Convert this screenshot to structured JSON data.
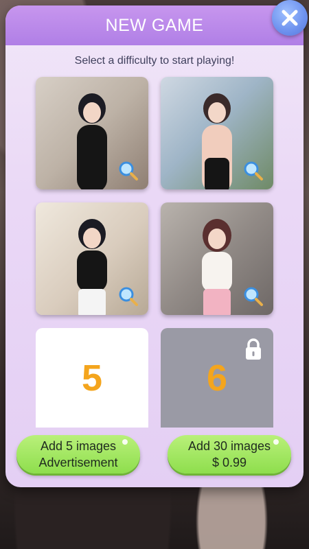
{
  "header": {
    "title": "NEW GAME",
    "close_icon": "close-icon"
  },
  "subtitle": "Select a difficulty to start playing!",
  "thumbnails": [
    {
      "name": "image-1",
      "icon": "magnifier-icon"
    },
    {
      "name": "image-2",
      "icon": "magnifier-icon"
    },
    {
      "name": "image-3",
      "icon": "magnifier-icon"
    },
    {
      "name": "image-4",
      "icon": "magnifier-icon"
    }
  ],
  "levels": [
    {
      "value": "5",
      "locked": false
    },
    {
      "value": "6",
      "locked": true,
      "icon": "lock-icon"
    }
  ],
  "buttons": {
    "ad": {
      "line1": "Add 5 images",
      "line2": "Advertisement"
    },
    "purchase": {
      "line1": "Add 30 images",
      "line2": "$ 0.99"
    }
  },
  "colors": {
    "header": "#b07fe6",
    "panel": "#ead8f6",
    "close_button": "#6d91ee",
    "level_number": "#f4a51d",
    "locked_card": "#9a9aa5",
    "button": "#8ede4d"
  }
}
